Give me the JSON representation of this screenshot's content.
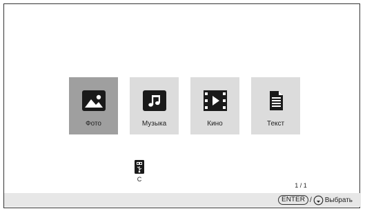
{
  "media_tabs": [
    {
      "label": "Фото",
      "icon": "photo-icon",
      "selected": true
    },
    {
      "label": "Музыка",
      "icon": "music-icon",
      "selected": false
    },
    {
      "label": "Кино",
      "icon": "movie-icon",
      "selected": false
    },
    {
      "label": "Текст",
      "icon": "text-document-icon",
      "selected": false
    }
  ],
  "device": {
    "label": "C",
    "icon": "usb-drive-icon"
  },
  "pager": {
    "text": "1 / 1"
  },
  "footer": {
    "enter_key": "ENTER",
    "separator": "/",
    "select_icon": "select-button-icon",
    "select_label": "Выбрать"
  },
  "colors": {
    "tile_selected": "#9f9f9f",
    "tile_normal": "#dcdcdc",
    "icon_dark": "#1a1a1a",
    "footer_bg": "#e7e7e7"
  }
}
